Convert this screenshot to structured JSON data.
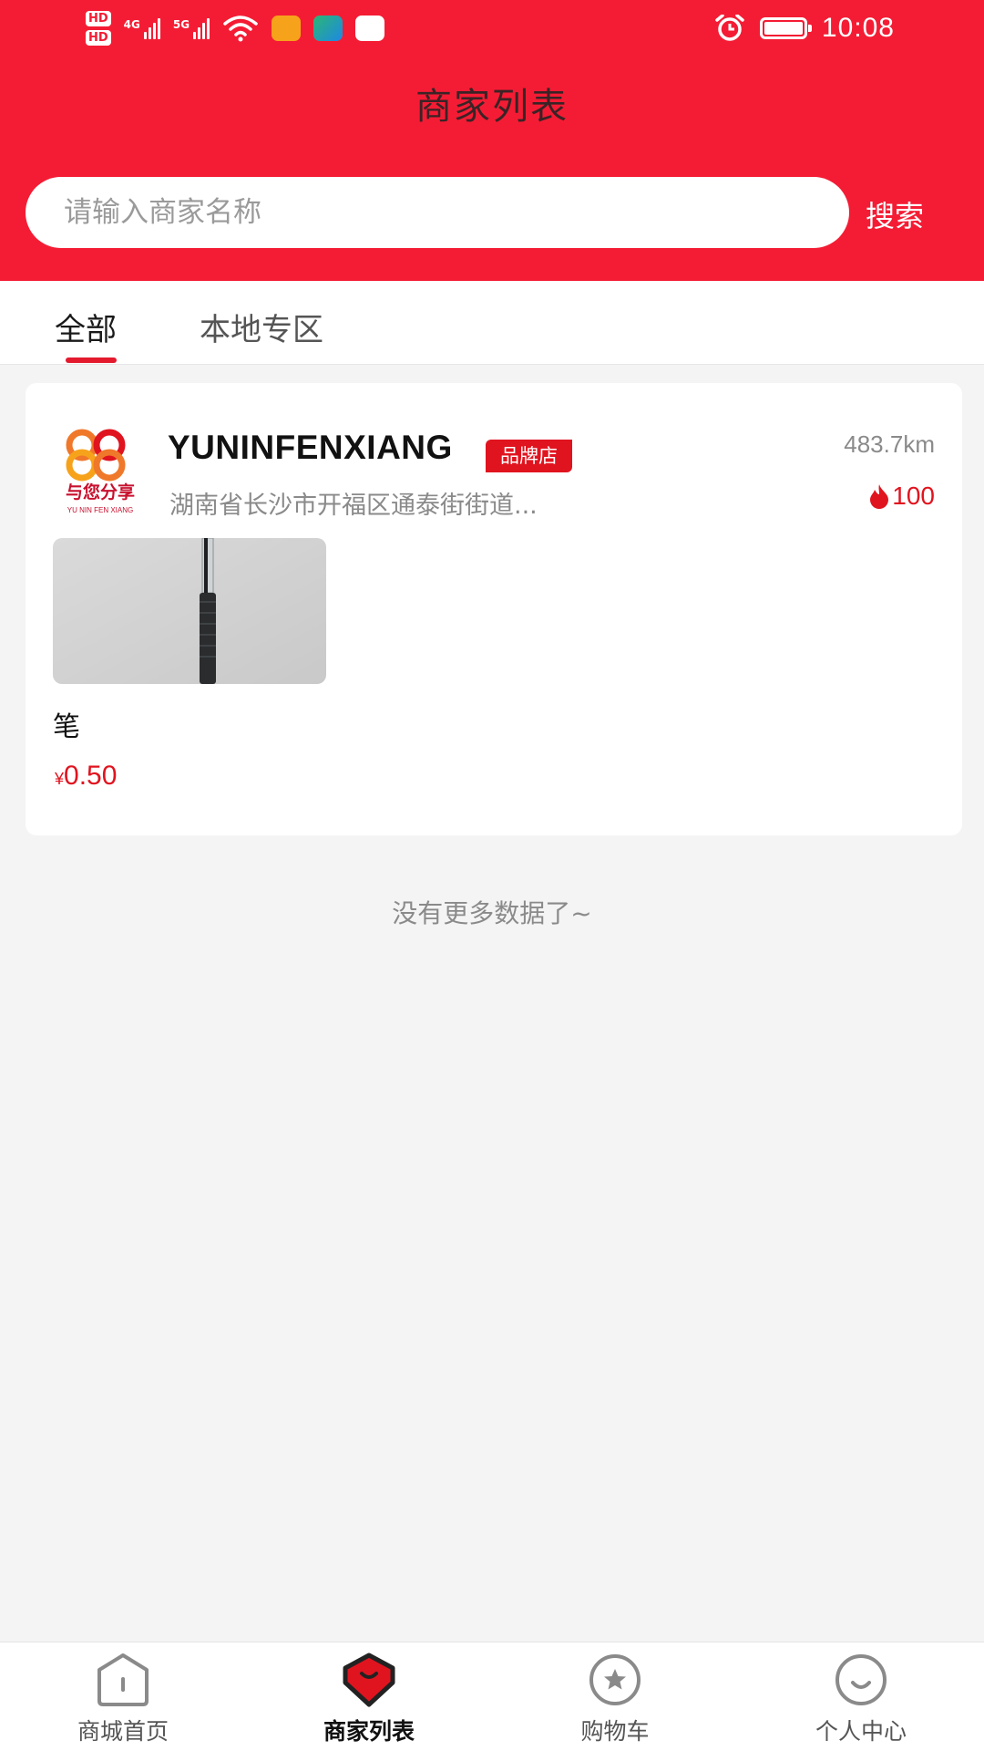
{
  "status_bar": {
    "time": "10:08",
    "hd_badges": [
      "HD",
      "HD"
    ],
    "network_labels": [
      "4G",
      "5G"
    ]
  },
  "header": {
    "title": "商家列表"
  },
  "search": {
    "placeholder": "请输入商家名称",
    "button_label": "搜索"
  },
  "tabs": [
    {
      "label": "全部",
      "active": true
    },
    {
      "label": "本地专区",
      "active": false
    }
  ],
  "merchant": {
    "logo_text": "与您分享",
    "logo_subtext": "YU NIN FEN XIANG",
    "name": "YUNINFENXIANG",
    "badge": "品牌店",
    "distance": "483.7km",
    "address": "湖南省长沙市开福区通泰街街道...",
    "hot_count": "100",
    "product": {
      "name": "笔",
      "currency": "¥",
      "price": "0.50"
    }
  },
  "list_end_text": "没有更多数据了~",
  "bottom_nav": [
    {
      "label": "商城首页",
      "icon": "home-icon",
      "active": false
    },
    {
      "label": "商家列表",
      "icon": "merchant-list-icon",
      "active": true
    },
    {
      "label": "购物车",
      "icon": "star-cart-icon",
      "active": false
    },
    {
      "label": "个人中心",
      "icon": "smile-profile-icon",
      "active": false
    }
  ],
  "colors": {
    "brand_red": "#f41c34",
    "accent_red": "#e0141f",
    "background": "#f4f4f4"
  }
}
